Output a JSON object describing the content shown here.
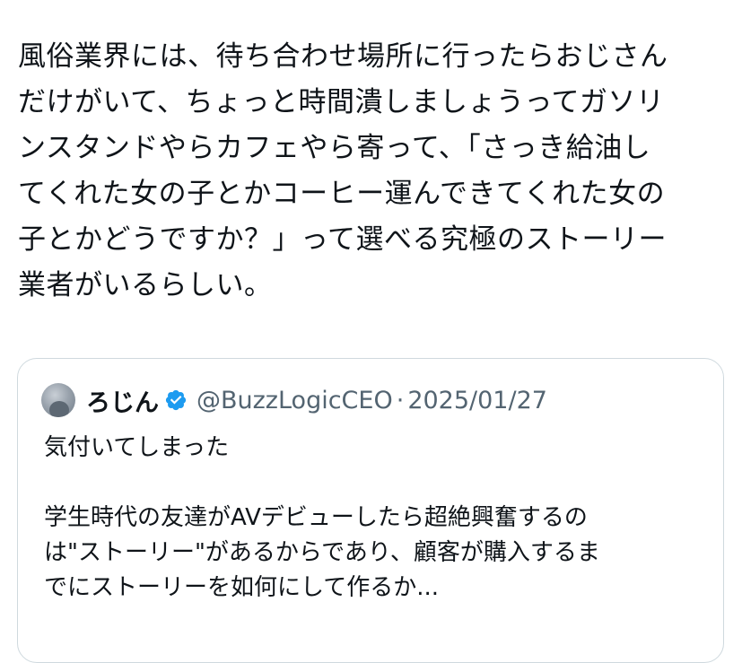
{
  "tweet": {
    "text": "風俗業界には、待ち合わせ場所に行ったらおじさん\nだけがいて、ちょっと時間潰しましょうってガソリ\nンスタンドやらカフェやら寄って、「さっき給油し\nてくれた女の子とかコーヒー運んできてくれた女の\n子とかどうですか？」って選べる究極のストーリー\n業者がいるらしい。"
  },
  "quote": {
    "author_name": "ろじん",
    "author_handle": "@BuzzLogicCEO",
    "separator": "·",
    "date": "2025/01/27",
    "verified_color": "#1d9bf0",
    "text": "気付いてしまった\n\n学生時代の友達がAVデビューしたら超絶興奮するの\nは\"ストーリー\"があるからであり、顧客が購入するま\nでにストーリーを如何にして作るか..."
  }
}
